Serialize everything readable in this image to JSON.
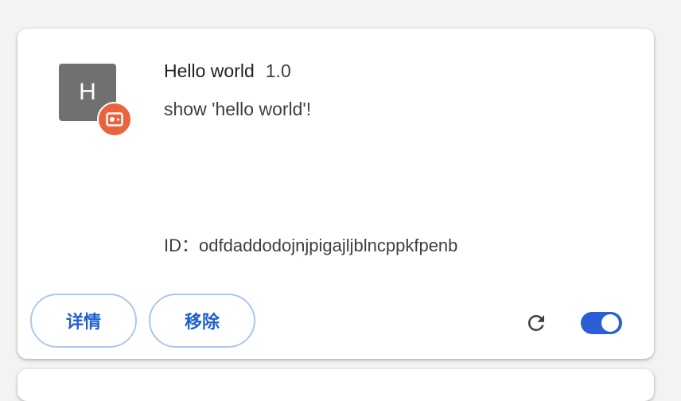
{
  "extension": {
    "icon_letter": "H",
    "name": "Hello world",
    "version": "1.0",
    "description": "show 'hello world'!",
    "id_label": "ID：",
    "id_value": "odfdaddodojnjpigajljblncppkfpenb",
    "enabled": true
  },
  "buttons": {
    "details_label": "详情",
    "remove_label": "移除"
  },
  "icons": {
    "source_badge": "unpacked-source-icon",
    "reload": "reload-icon"
  },
  "colors": {
    "accent": "#1f5fd1",
    "toggle_on": "#2c5fd3",
    "badge": "#e8643c",
    "icon_bg": "#707070"
  }
}
